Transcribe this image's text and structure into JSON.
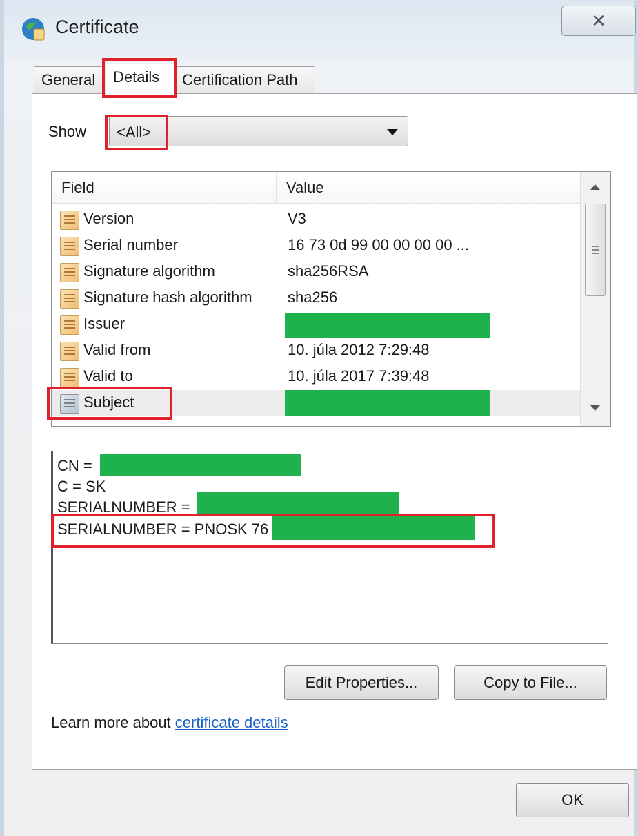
{
  "window": {
    "title": "Certificate",
    "close_glyph": "✕",
    "icon": "certificate-icon"
  },
  "tabs": [
    {
      "label": "General"
    },
    {
      "label": "Details"
    },
    {
      "label": "Certification Path"
    }
  ],
  "show": {
    "label": "Show",
    "selected": "<All>"
  },
  "fields": {
    "columns": [
      "Field",
      "Value"
    ],
    "rows": [
      {
        "field": "Version",
        "value": "V3"
      },
      {
        "field": "Serial number",
        "value": "16 73 0d 99 00 00 00 00 ..."
      },
      {
        "field": "Signature algorithm",
        "value": "sha256RSA"
      },
      {
        "field": "Signature hash algorithm",
        "value": "sha256"
      },
      {
        "field": "Issuer",
        "value": ""
      },
      {
        "field": "Valid from",
        "value": "10. júla 2012 7:29:48"
      },
      {
        "field": "Valid to",
        "value": "10. júla 2017 7:39:48"
      },
      {
        "field": "Subject",
        "value": ""
      }
    ]
  },
  "detail": {
    "lines": [
      "CN =",
      "C = SK",
      "SERIALNUMBER =",
      "SERIALNUMBER = PNOSK 76"
    ]
  },
  "buttons": {
    "edit_properties": "Edit Properties...",
    "copy_to_file": "Copy to File...",
    "ok": "OK"
  },
  "learn_more": {
    "text": "Learn more about",
    "link": "certificate details"
  },
  "colors": {
    "highlight": "#e0202a",
    "redaction": "#1fb14c",
    "link": "#1a63c6"
  }
}
